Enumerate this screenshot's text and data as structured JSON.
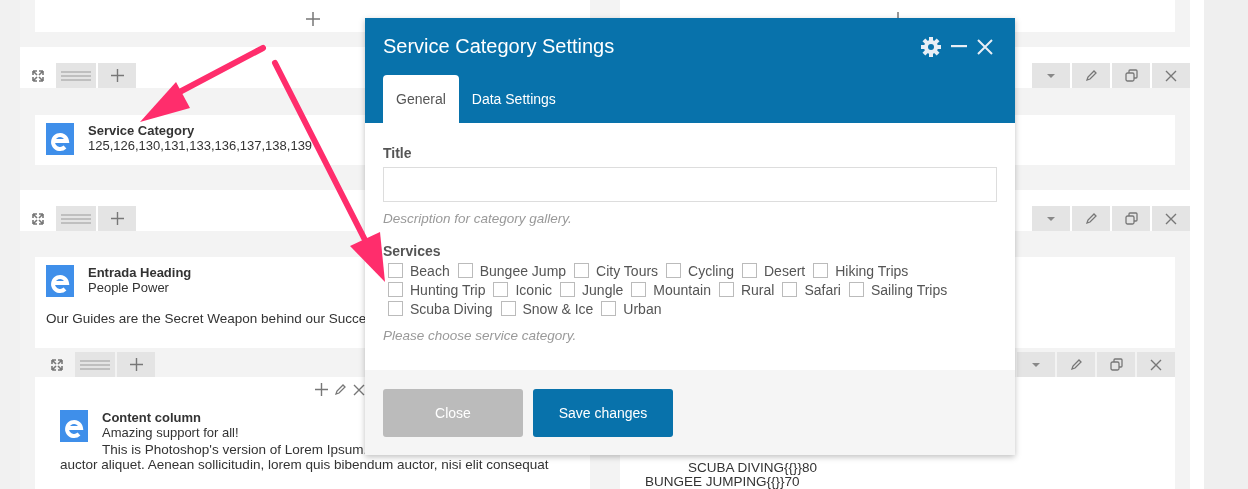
{
  "elements": [
    {
      "title": "Service Category",
      "subtitle": "125,126,130,131,133,136,137,138,139"
    },
    {
      "title": "Entrada Heading",
      "subtitle": "People Power",
      "text": "Our Guides are the Secret Weapon behind our Succe"
    }
  ],
  "columns": [
    {
      "title": "Content column",
      "subtitle": "Amazing support for all!",
      "body": [
        "This is Photoshop's version of Lorem Ipsum.",
        "auctor aliquet. Aenean sollicitudin, lorem quis bibendum auctor, nisi elit consequat"
      ]
    },
    {
      "lines": [
        "SCUBA DIVING{{}}80",
        "BUNGEE JUMPING{{}}70"
      ]
    }
  ],
  "modal": {
    "title": "Service Category Settings",
    "tabs": [
      {
        "label": "General",
        "selected": true
      },
      {
        "label": "Data Settings",
        "selected": false
      }
    ],
    "title_field": {
      "label": "Title",
      "description": "Description for category gallery."
    },
    "services": {
      "label": "Services",
      "hint": "Please choose service category.",
      "options": [
        {
          "label": "Beach",
          "checked": false
        },
        {
          "label": "Bungee Jump",
          "checked": false
        },
        {
          "label": "City Tours",
          "checked": false
        },
        {
          "label": "Cycling",
          "checked": false
        },
        {
          "label": "Desert",
          "checked": false
        },
        {
          "label": "Hiking Trips",
          "checked": false
        },
        {
          "label": "Hunting Trip",
          "checked": false
        },
        {
          "label": "Iconic",
          "checked": false
        },
        {
          "label": "Jungle",
          "checked": false
        },
        {
          "label": "Mountain",
          "checked": false
        },
        {
          "label": "Rural",
          "checked": false
        },
        {
          "label": "Safari",
          "checked": false
        },
        {
          "label": "Sailing Trips",
          "checked": false
        },
        {
          "label": "Scuba Diving",
          "checked": false
        },
        {
          "label": "Snow & Ice",
          "checked": false
        },
        {
          "label": "Urban",
          "checked": false
        }
      ]
    },
    "buttons": [
      {
        "label": "Close",
        "kind": "secondary"
      },
      {
        "label": "Save changes",
        "kind": "primary"
      }
    ]
  }
}
